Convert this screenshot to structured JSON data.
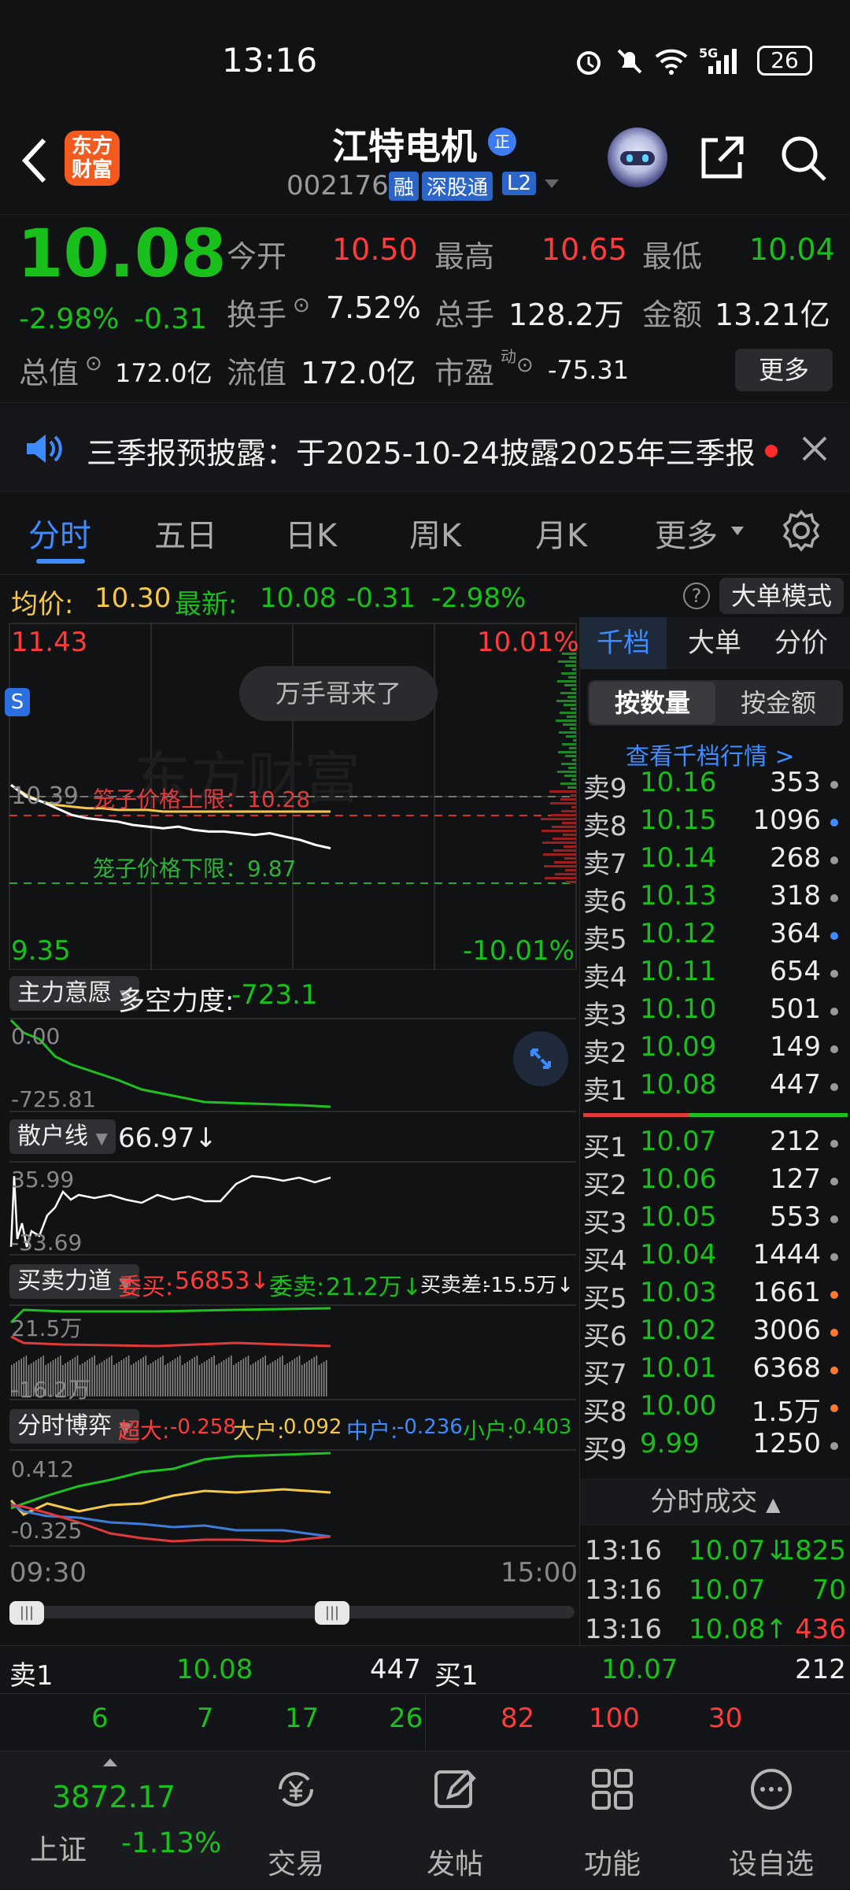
{
  "status": {
    "time": "13:16",
    "battery": "26",
    "signal": "5G"
  },
  "header": {
    "logo_line1": "东方",
    "logo_line2": "财富",
    "title": "江特电机",
    "title_badge": "正",
    "code": "002176",
    "badges": [
      "融",
      "深股通",
      "L2"
    ]
  },
  "quote": {
    "price": "10.08",
    "change_pct": "-2.98%",
    "change": "-0.31",
    "open_label": "今开",
    "open": "10.50",
    "high_label": "最高",
    "high": "10.65",
    "low_label": "最低",
    "low": "10.04",
    "turnover_label": "换手",
    "turnover": "7.52%",
    "volume_label": "总手",
    "volume": "128.2万",
    "amount_label": "金额",
    "amount": "13.21亿",
    "mktcap_label": "总值",
    "mktcap": "172.0亿",
    "float_label": "流值",
    "float_cap": "172.0亿",
    "pe_label": "市盈",
    "pe_sup": "动",
    "pe": "-75.31",
    "more": "更多"
  },
  "notice": {
    "text": "三季报预披露：于2025-10-24披露2025年三季报"
  },
  "tabs": [
    "分时",
    "五日",
    "日K",
    "周K",
    "月K",
    "更多"
  ],
  "avgbar": {
    "avg_label": "均价:",
    "avg": "10.30",
    "latest_label": "最新:",
    "latest": "10.08",
    "chg": "-0.31",
    "chg_pct": "-2.98%",
    "bigorder_btn": "大单模式"
  },
  "chart": {
    "top_price": "11.43",
    "top_pct": "10.01%",
    "bottom_price": "9.35",
    "bottom_pct": "-10.01%",
    "ref_price": "10.39",
    "cage_upper": "笼子价格上限：10.28",
    "cage_lower": "笼子价格下限：9.87",
    "bubble": "万手哥来了",
    "s_mark": "S",
    "watermark": "东方财富",
    "time_start": "09:30",
    "time_end": "15:00"
  },
  "chart_data": {
    "type": "line",
    "ylim": [
      9.35,
      11.43
    ],
    "x_range": [
      "09:30",
      "15:00"
    ],
    "series": [
      {
        "values": [
          10.46,
          10.39,
          10.36,
          10.32,
          10.28,
          10.26,
          10.25,
          10.24,
          10.22,
          10.21,
          10.2,
          10.21,
          10.19,
          10.18,
          10.18,
          10.17,
          10.16,
          10.17,
          10.15,
          10.13,
          10.1,
          10.08
        ]
      },
      {
        "values": [
          10.46,
          10.4,
          10.36,
          10.34,
          10.33,
          10.32,
          10.32,
          10.31,
          10.31,
          10.31,
          10.3,
          10.3,
          10.3,
          10.3,
          10.3,
          10.3,
          10.3,
          10.3,
          10.3,
          10.3,
          10.3,
          10.3
        ]
      }
    ]
  },
  "ind1": {
    "label": "主力意愿",
    "title": "多空力度:",
    "value": "-723.1",
    "top": "0.00",
    "bottom": "-725.81"
  },
  "ind2": {
    "label": "散户线",
    "value": "66.97↓",
    "top": "35.99",
    "bottom": "-33.69"
  },
  "ind3": {
    "label": "买卖力道",
    "buy_label": "委买:",
    "buy": "56853↓",
    "sell_label": "委卖:",
    "sell": "21.2万↓",
    "diff_label": "买卖差:",
    "diff": "-15.5万↓",
    "top": "21.5万",
    "bottom": "-16.2万"
  },
  "ind4": {
    "label": "分时博弈",
    "super_label": "超大:",
    "super": "-0.258",
    "big_label": "大户:",
    "big": "0.092",
    "mid_label": "中户:",
    "mid": "-0.236",
    "small_label": "小户:",
    "small": "0.403",
    "top": "0.412",
    "bottom": "-0.325"
  },
  "orderbook": {
    "tabs": [
      "千档",
      "大单",
      "分价"
    ],
    "sub_tabs": [
      "按数量",
      "按金额"
    ],
    "link": "查看千档行情 >",
    "asks": [
      {
        "l": "卖9",
        "p": "10.16",
        "v": "353",
        "dot": "#9a9a9a"
      },
      {
        "l": "卖8",
        "p": "10.15",
        "v": "1096",
        "dot": "#3d8bff"
      },
      {
        "l": "卖7",
        "p": "10.14",
        "v": "268",
        "dot": "#9a9a9a"
      },
      {
        "l": "卖6",
        "p": "10.13",
        "v": "318",
        "dot": "#9a9a9a"
      },
      {
        "l": "卖5",
        "p": "10.12",
        "v": "364",
        "dot": "#3d8bff"
      },
      {
        "l": "卖4",
        "p": "10.11",
        "v": "654",
        "dot": "#9a9a9a"
      },
      {
        "l": "卖3",
        "p": "10.10",
        "v": "501",
        "dot": "#9a9a9a"
      },
      {
        "l": "卖2",
        "p": "10.09",
        "v": "149",
        "dot": "#9a9a9a"
      },
      {
        "l": "卖1",
        "p": "10.08",
        "v": "447",
        "dot": "#9a9a9a"
      }
    ],
    "bids": [
      {
        "l": "买1",
        "p": "10.07",
        "v": "212",
        "dot": "#9a9a9a"
      },
      {
        "l": "买2",
        "p": "10.06",
        "v": "127",
        "dot": "#9a9a9a"
      },
      {
        "l": "买3",
        "p": "10.05",
        "v": "553",
        "dot": "#9a9a9a"
      },
      {
        "l": "买4",
        "p": "10.04",
        "v": "1444",
        "dot": "#9a9a9a"
      },
      {
        "l": "买5",
        "p": "10.03",
        "v": "1661",
        "dot": "#ff7a2e"
      },
      {
        "l": "买6",
        "p": "10.02",
        "v": "3006",
        "dot": "#ff7a2e"
      },
      {
        "l": "买7",
        "p": "10.01",
        "v": "6368",
        "dot": "#ff7a2e"
      },
      {
        "l": "买8",
        "p": "10.00",
        "v": "1.5万",
        "dot": "#ff7a2e"
      },
      {
        "l": "买9",
        "p": "9.99",
        "v": "1250",
        "dot": "#9a9a9a"
      }
    ]
  },
  "trades": {
    "title": "分时成交",
    "rows": [
      {
        "t": "13:16",
        "p": "10.07↓",
        "v": "1825",
        "vc": "green"
      },
      {
        "t": "13:16",
        "p": "10.07",
        "v": "70",
        "vc": "green"
      },
      {
        "t": "13:16",
        "p": "10.08↑",
        "v": "436",
        "vc": "red"
      }
    ]
  },
  "level1": {
    "sell_label": "卖1",
    "sell_price": "10.08",
    "sell_vol": "447",
    "buy_label": "买1",
    "buy_price": "10.07",
    "buy_vol": "212",
    "sell_queue": [
      "6",
      "7",
      "17",
      "26"
    ],
    "buy_queue": [
      "82",
      "100",
      "30"
    ]
  },
  "bottomnav": {
    "index_value": "3872.17",
    "index_name": "上证",
    "index_change": "-1.13%",
    "items": [
      "交易",
      "发帖",
      "功能",
      "设自选"
    ]
  }
}
